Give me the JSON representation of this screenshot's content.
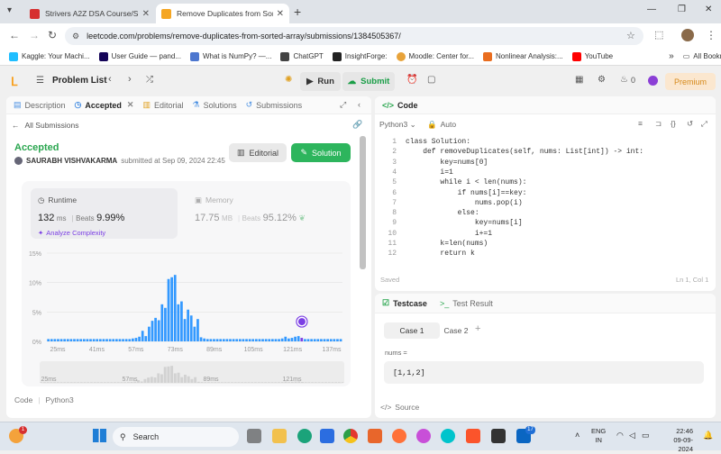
{
  "browser": {
    "tabs": [
      {
        "label": "Strivers A2Z DSA Course/Sheet",
        "favicon_color": "#d62f2f",
        "active": false
      },
      {
        "label": "Remove Duplicates from Sorted",
        "favicon_color": "#f5a623",
        "active": true
      }
    ],
    "new_tab_symbol": "+",
    "url": "leetcode.com/problems/remove-duplicates-from-sorted-array/submissions/1384505367/",
    "bookmarks": [
      {
        "label": "Kaggle: Your Machi...",
        "color": "#20beff"
      },
      {
        "label": "User Guide — pand...",
        "color": "#150458"
      },
      {
        "label": "What is NumPy? —...",
        "color": "#4d77cf"
      },
      {
        "label": "ChatGPT",
        "color": "#444444"
      },
      {
        "label": "InsightForge:",
        "color": "#222222"
      },
      {
        "label": "Moodle: Center for...",
        "color": "#e8a33a"
      },
      {
        "label": "Nonlinear Analysis:...",
        "color": "#e96d1f"
      },
      {
        "label": "YouTube",
        "color": "#ff0000"
      }
    ],
    "more_symbol": "»",
    "all_bookmarks": "All Bookmarks"
  },
  "leetcode": {
    "problem_list": "Problem List",
    "run": "Run",
    "submit": "Submit",
    "notifications": "0",
    "premium": "Premium",
    "left_tabs": [
      "Description",
      "Accepted",
      "Editorial",
      "Solutions",
      "Submissions"
    ],
    "all_submissions": "All Submissions",
    "status": "Accepted",
    "user": "SAURABH VISHVAKARMA",
    "submitted": "submitted at Sep 09, 2024 22:45",
    "editorial_btn": "Editorial",
    "solution_btn": "Solution",
    "runtime_label": "Runtime",
    "runtime_value": "132",
    "runtime_unit": "ms",
    "beats_label": "Beats",
    "runtime_beats": "9.99%",
    "analyze": "Analyze Complexity",
    "memory_label": "Memory",
    "memory_value": "17.75",
    "memory_unit": "MB",
    "memory_beats": "95.12%",
    "bottom_code_label": "Code",
    "bottom_lang": "Python3",
    "code_tab": "Code",
    "lang": "Python3",
    "auto": "Auto",
    "saved": "Saved",
    "cursor": "Ln 1, Col 1",
    "code_lines": [
      "class Solution:",
      "    def removeDuplicates(self, nums: List[int]) -> int:",
      "        key=nums[0]",
      "        i=1",
      "        while i < len(nums):",
      "            if nums[i]==key:",
      "                nums.pop(i)",
      "            else:",
      "                key=nums[i]",
      "                i+=1",
      "        k=len(nums)",
      "        return k"
    ],
    "testcase_tab": "Testcase",
    "test_result_tab": "Test Result",
    "cases": [
      "Case 1",
      "Case 2"
    ],
    "add_case": "+",
    "nums_label": "nums =",
    "nums_value": "[1,1,2]",
    "source": "Source"
  },
  "chart_data": {
    "type": "bar",
    "title": "",
    "xlabel": "",
    "ylabel": "",
    "ylim": [
      0,
      15
    ],
    "yticks": [
      "15%",
      "10%",
      "5%",
      "0%"
    ],
    "xticks": [
      "25ms",
      "41ms",
      "57ms",
      "73ms",
      "89ms",
      "105ms",
      "121ms",
      "137ms"
    ],
    "mini_xticks": [
      "25ms",
      "57ms",
      "89ms",
      "121ms"
    ],
    "values": [
      0.4,
      0.4,
      0.4,
      0.4,
      0.4,
      0.4,
      0.4,
      0.4,
      0.4,
      0.4,
      0.4,
      0.4,
      0.4,
      0.4,
      0.4,
      0.4,
      0.4,
      0.4,
      0.4,
      0.4,
      0.4,
      0.4,
      0.4,
      0.4,
      0.4,
      0.4,
      0.5,
      0.6,
      0.8,
      1.8,
      0.9,
      2.5,
      3.5,
      4.0,
      3.6,
      6.3,
      5.7,
      10.6,
      10.9,
      11.3,
      6.3,
      6.8,
      3.8,
      5.4,
      4.4,
      2.5,
      3.8,
      0.7,
      0.5,
      0.4,
      0.4,
      0.4,
      0.4,
      0.4,
      0.4,
      0.4,
      0.4,
      0.4,
      0.4,
      0.4,
      0.4,
      0.4,
      0.4,
      0.4,
      0.4,
      0.4,
      0.4,
      0.4,
      0.4,
      0.4,
      0.4,
      0.4,
      0.5,
      0.8,
      0.5,
      0.6,
      0.8,
      0.9,
      0.6,
      0.4,
      0.4,
      0.4,
      0.4,
      0.4,
      0.4,
      0.4,
      0.4,
      0.4,
      0.4,
      0.4,
      0.4
    ],
    "highlight_index": 78,
    "bar_color": "#3399ff",
    "highlight_color": "#7b3fe4"
  },
  "taskbar": {
    "search": "Search",
    "lang1": "ENG",
    "lang2": "IN",
    "time": "22:46",
    "date": "09-09-2024",
    "badge": "1",
    "linkedin_badge": "17"
  }
}
